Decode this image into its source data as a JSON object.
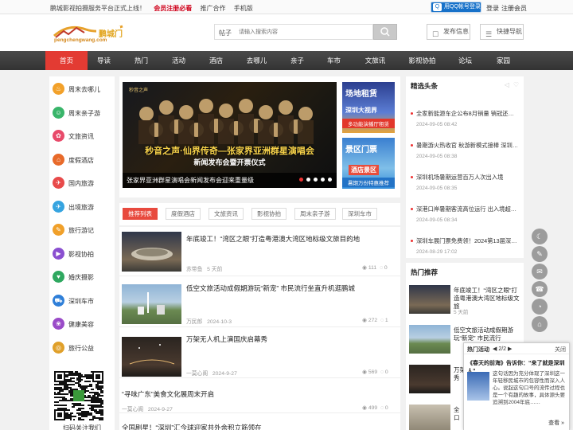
{
  "topbar": {
    "slogan": "鹏城影视拍摄服务平台正式上线！",
    "vip": "会员注册必看",
    "promo": "推广合作",
    "mobile": "手机版",
    "qq_login": "用QQ帐号登录",
    "login": "登录",
    "register": "注册会员"
  },
  "header": {
    "logo_text": "鹏城门",
    "logo_domain": "pengchengwang.com",
    "search_label": "帖子",
    "search_placeholder": "请输入搜索内容",
    "publish": "发布信息",
    "quicknav": "快捷导航"
  },
  "nav": [
    "首页",
    "导读",
    "热门",
    "活动",
    "酒店",
    "去哪儿",
    "亲子",
    "车市",
    "文旅讯",
    "影视协拍",
    "论坛",
    "家园"
  ],
  "sidebar": [
    {
      "label": "周末去哪儿",
      "color": "#f2a12a",
      "icon": "♨"
    },
    {
      "label": "周末亲子游",
      "color": "#39b56a",
      "icon": "☺"
    },
    {
      "label": "文旅资讯",
      "color": "#e84a6a",
      "icon": "✿"
    },
    {
      "label": "度假酒店",
      "color": "#e86a2a",
      "icon": "⌂"
    },
    {
      "label": "国内旅游",
      "color": "#e84a4a",
      "icon": "✈"
    },
    {
      "label": "出境旅游",
      "color": "#36a4e0",
      "icon": "✈"
    },
    {
      "label": "旅行游记",
      "color": "#f0a02a",
      "icon": "✎"
    },
    {
      "label": "影视协拍",
      "color": "#8a4fd0",
      "icon": "▶"
    },
    {
      "label": "婚庆摄影",
      "color": "#2fa860",
      "icon": "♥"
    },
    {
      "label": "深圳车市",
      "color": "#2f7fd8",
      "icon": "⛟"
    },
    {
      "label": "健康美容",
      "color": "#9a4bc8",
      "icon": "❀"
    },
    {
      "label": "旅行公益",
      "color": "#e0a02a",
      "icon": "◎"
    }
  ],
  "qr_caption": "扫码关注我们",
  "banner": {
    "title": "秒音之声·仙界传奇—张家界亚洲群星演唱会",
    "subtitle": "新闻发布会暨开票仪式",
    "caption": "张家界亚洲群星演唱会新闻发布会迎来重量级",
    "dots": 5,
    "active_dot": 1
  },
  "side_thumbs": [
    {
      "title": "场地租赁",
      "sub": "深圳大视界",
      "sub2": "多功能演播厅租赁"
    },
    {
      "title": "景区门票",
      "sub": "酒店景区",
      "sub2": "暑期万份特惠推荐"
    }
  ],
  "tabs": [
    "推荐列表",
    "度假酒店",
    "文旅资讯",
    "影视协拍",
    "周末亲子游",
    "深圳车市"
  ],
  "news": [
    {
      "title": "年底竣工！“湾区之眼”打造粤港澳大湾区地标级文旅目的地",
      "author": "苏带鱼",
      "time": "5 天前",
      "views": "111",
      "comments": "0"
    },
    {
      "title": "低空文旅活动成假期游玩“新宠” 市民流行坐直升机逛鹏城",
      "author": "万民郎",
      "time": "2024-10-3",
      "views": "272",
      "comments": "1"
    },
    {
      "title": "万架无人机上演国庆启幕秀",
      "author": "一莫心阁",
      "time": "2024-9-27",
      "views": "569",
      "comments": "0"
    },
    {
      "title": "“寻味广东”美食文化展周末开启",
      "author": "一莫心阁",
      "time": "2024-9-27",
      "views": "499",
      "comments": "0"
    },
    {
      "title": "全国剧星！“深圳”汇今球迎家共外余积立筋领在",
      "author": "",
      "time": "",
      "views": "",
      "comments": ""
    }
  ],
  "picks": {
    "title": "精选头条",
    "items": [
      {
        "title": "全家新能源车企公布8月销量 销冠还…",
        "date": "2024-09-05 08:42"
      },
      {
        "title": "暑期游火热收官 秋游新模式接棒 深圳…",
        "date": "2024-09-05 08:38"
      },
      {
        "title": "深圳机场暑期运营百万人次出入境",
        "date": "2024-09-05 08:35"
      },
      {
        "title": "深港口岸暑期客流高位运行 出入境超…",
        "date": "2024-09-05 08:34"
      },
      {
        "title": "深圳车展门票免费领！2024第13届深…",
        "date": "2024-08-29 17:02"
      }
    ]
  },
  "hot": {
    "title": "热门推荐",
    "items": [
      {
        "title": "年底竣工！“湾区之眼”打\n造粤港澳大湾区地标级文旅",
        "meta": "5 天前"
      },
      {
        "title": "低空文旅活动成假期游\n玩“新宠” 市民流行",
        "meta": ""
      },
      {
        "title": "万架无人机\n秀",
        "meta": ""
      },
      {
        "title": "全\n口",
        "meta": ""
      }
    ]
  },
  "popup": {
    "header": "热门活动",
    "pager": "2/2",
    "close": "关闭",
    "title": "《春天的前海》告诉你：“来了就是深圳人”",
    "desc": "这句话因为充分体现了深圳这一年轻移民城市的包容性而深入人心。说起这句口号的流传过程也是一个有趣的故事，具体源头要追溯到2004年底……",
    "more": "查看 »"
  },
  "floatbar": [
    "☾",
    "✎",
    "✉",
    "☎",
    "◔",
    "⌂"
  ]
}
